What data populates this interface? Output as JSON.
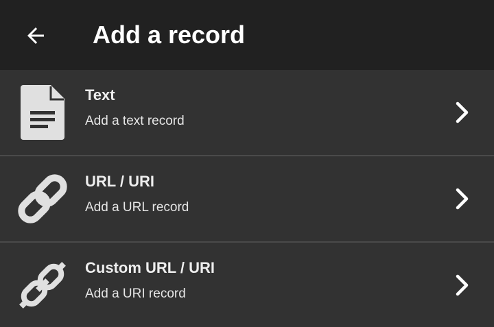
{
  "appbar": {
    "title": "Add a record",
    "back_icon": "arrow-left-icon"
  },
  "colors": {
    "appbar_bg": "#212121",
    "list_bg": "#323232",
    "divider": "#4a4a4a",
    "icon": "#e0e0e0",
    "text": "#eeeeee"
  },
  "records": [
    {
      "title": "Text",
      "subtitle": "Add a text record",
      "icon": "document-text-icon"
    },
    {
      "title": "URL / URI",
      "subtitle": "Add a URL record",
      "icon": "link-icon"
    },
    {
      "title": "Custom URL / URI",
      "subtitle": "Add a URI record",
      "icon": "custom-link-icon"
    }
  ]
}
